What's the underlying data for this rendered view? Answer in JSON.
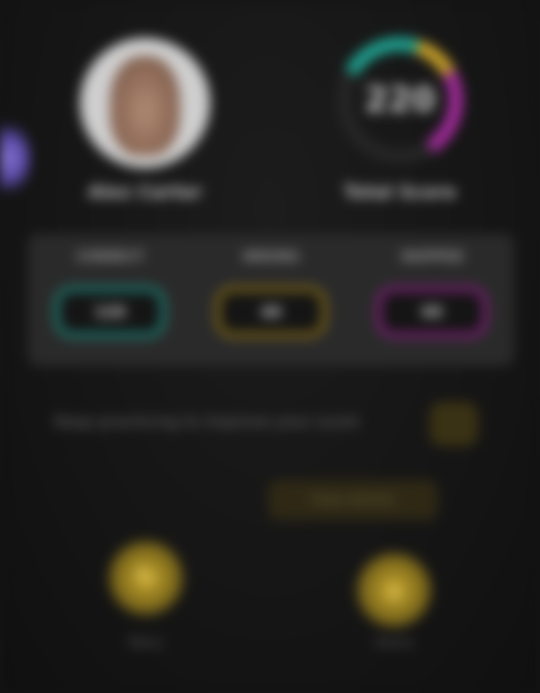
{
  "profile": {
    "name": "Alex Carter",
    "avatar_icon": "user-photo"
  },
  "score": {
    "value": "220",
    "label": "Total Score",
    "segments": [
      {
        "color": "#1fa08f",
        "fraction": 0.22
      },
      {
        "color": "#c9a22a",
        "fraction": 0.12
      },
      {
        "color": "#a12b9a",
        "fraction": 0.24
      }
    ]
  },
  "stats": [
    {
      "label": "CORRECT",
      "value": "120",
      "color": "#1e7a70"
    },
    {
      "label": "WRONG",
      "value": "40",
      "color": "#7a6318"
    },
    {
      "label": "SKIPPED",
      "value": "60",
      "color": "#7a1f74"
    }
  ],
  "progress_row": {
    "text": "Keep practicing to improve your score"
  },
  "hint": {
    "label": "View details"
  },
  "actions": [
    {
      "label": "Retry",
      "icon": "refresh-icon",
      "glyph": "↻"
    },
    {
      "label": "Home",
      "icon": "home-icon",
      "glyph": "⌂"
    }
  ],
  "colors": {
    "background": "#141414",
    "panel": "#2a2a2a",
    "accent_gold": "#c7a52a",
    "accent_teal": "#1fa08f",
    "accent_magenta": "#a12b9a"
  }
}
